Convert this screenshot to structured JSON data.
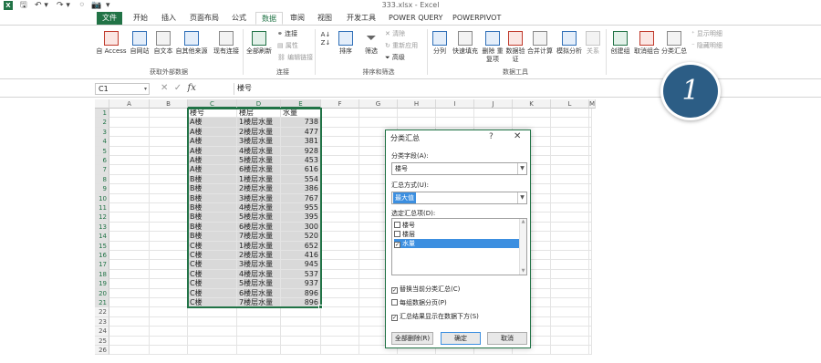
{
  "window": {
    "title": "333.xlsx - Excel",
    "qat": [
      "X",
      "🖫",
      "↶ ▾",
      "↷ ▾",
      "⚪",
      "📷",
      "▾"
    ]
  },
  "tabs": [
    {
      "label": "文件",
      "kind": "file"
    },
    {
      "label": "开始"
    },
    {
      "label": "插入"
    },
    {
      "label": "页面布局"
    },
    {
      "label": "公式"
    },
    {
      "label": "数据",
      "kind": "active"
    },
    {
      "label": "审阅"
    },
    {
      "label": "视图"
    },
    {
      "label": "开发工具"
    },
    {
      "label": "POWER QUERY"
    },
    {
      "label": "POWERPIVOT"
    }
  ],
  "ribbon": {
    "get_external": {
      "buttons": [
        "自 Access",
        "自网站",
        "自文本",
        "自其他来源"
      ],
      "existing": "现有连接",
      "group": "获取外部数据"
    },
    "connections": {
      "refresh": "全部刷新",
      "items": [
        "连接",
        "属性",
        "编辑链接"
      ],
      "group": "连接"
    },
    "sort_filter": {
      "sort": "排序",
      "filter": "筛选",
      "items": [
        "清除",
        "重新应用",
        "高级"
      ],
      "group": "排序和筛选"
    },
    "data_tools": {
      "buttons": [
        "分列",
        "快速填充",
        "删除 重复项",
        "数据验 证",
        "合并计算",
        "模拟分析",
        "关系"
      ],
      "group": "数据工具"
    },
    "outline": {
      "buttons": [
        "创建组",
        "取消组合",
        "分类汇总"
      ],
      "items": [
        "显示明细",
        "隐藏明细"
      ]
    }
  },
  "formula_bar": {
    "name_box": "C1",
    "fx": "fx",
    "content": "楼号"
  },
  "sheet": {
    "columns": [
      "A",
      "B",
      "C",
      "D",
      "E",
      "F",
      "G",
      "H",
      "I",
      "J",
      "K",
      "L",
      "M"
    ],
    "rows": [
      "1",
      "2",
      "3",
      "4",
      "5",
      "6",
      "7",
      "8",
      "9",
      "10",
      "11",
      "12",
      "13",
      "14",
      "15",
      "16",
      "17",
      "18",
      "19",
      "20",
      "21",
      "22",
      "23",
      "24",
      "25",
      "26"
    ],
    "headers": [
      "楼号",
      "楼层",
      "水量"
    ],
    "data": [
      [
        "A楼",
        "1楼层水量",
        "738"
      ],
      [
        "A楼",
        "2楼层水量",
        "477"
      ],
      [
        "A楼",
        "3楼层水量",
        "381"
      ],
      [
        "A楼",
        "4楼层水量",
        "928"
      ],
      [
        "A楼",
        "5楼层水量",
        "453"
      ],
      [
        "A楼",
        "6楼层水量",
        "616"
      ],
      [
        "B楼",
        "1楼层水量",
        "554"
      ],
      [
        "B楼",
        "2楼层水量",
        "386"
      ],
      [
        "B楼",
        "3楼层水量",
        "767"
      ],
      [
        "B楼",
        "4楼层水量",
        "955"
      ],
      [
        "B楼",
        "5楼层水量",
        "395"
      ],
      [
        "B楼",
        "6楼层水量",
        "300"
      ],
      [
        "B楼",
        "7楼层水量",
        "520"
      ],
      [
        "C楼",
        "1楼层水量",
        "652"
      ],
      [
        "C楼",
        "2楼层水量",
        "416"
      ],
      [
        "C楼",
        "3楼层水量",
        "945"
      ],
      [
        "C楼",
        "4楼层水量",
        "537"
      ],
      [
        "C楼",
        "5楼层水量",
        "937"
      ],
      [
        "C楼",
        "6楼层水量",
        "896"
      ],
      [
        "C楼",
        "7楼层水量",
        "896"
      ]
    ]
  },
  "dialog": {
    "title": "分类汇总",
    "help": "?",
    "close": "✕",
    "group_by_label": "分类字段(A):",
    "group_by_value": "楼号",
    "function_label": "汇总方式(U):",
    "function_value": "最大值",
    "add_to_label": "选定汇总项(D):",
    "fields": [
      {
        "label": "楼号",
        "checked": false
      },
      {
        "label": "楼层",
        "checked": false
      },
      {
        "label": "水量",
        "checked": true
      }
    ],
    "options": [
      {
        "label": "替换当前分类汇总(C)",
        "checked": true
      },
      {
        "label": "每组数据分页(P)",
        "checked": false
      },
      {
        "label": "汇总结果显示在数据下方(S)",
        "checked": true
      }
    ],
    "remove_all": "全部删除(R)",
    "ok": "确定",
    "cancel": "取消"
  },
  "badge": "1",
  "colors": {
    "excel_green": "#217346",
    "highlight": "#3c8fe0",
    "badge": "#2c5d85"
  }
}
